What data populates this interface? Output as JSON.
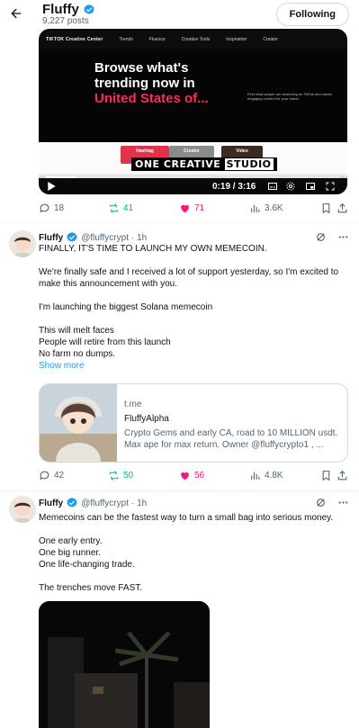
{
  "header": {
    "name": "Fluffy",
    "post_count": "9,227 posts",
    "follow_button": "Following"
  },
  "video": {
    "nav": [
      "TIKTOK Creative Center",
      "Trends",
      "Fluence",
      "Creative Tools",
      "Inspiration",
      "Creator"
    ],
    "headline_line1": "Browse what's",
    "headline_line2": "trending now in",
    "headline_highlight": "United States of...",
    "side_text": "Find what people are searching on TikTok and create engaging content for your brand.",
    "chips": [
      "Hashtag",
      "Creator",
      "Video"
    ],
    "overlay_brand": "ONE CREATIVE",
    "overlay_brand_highlight": "STUDIO",
    "time": "0:19 / 3:16",
    "progress": 0.1
  },
  "post1_actions": {
    "replies": "18",
    "reposts": "41",
    "likes": "71",
    "views": "3.6K"
  },
  "tweet2": {
    "name": "Fluffy",
    "handle": "@fluffycrypt",
    "time": "· 1h",
    "lines": [
      "FINALLY, IT'S TIME TO LAUNCH MY OWN MEMECOIN.",
      "We're finally safe and I received a lot of support yesterday, so I'm excited to make this announcement with you.",
      "I'm launching the biggest Solana memecoin",
      "This will melt faces\nPeople will retire from this launch\nNo farm no dumps."
    ],
    "show_more": "Show more",
    "card": {
      "domain": "t.me",
      "title": "FluffyAlpha",
      "description": "Crypto Gems and early CA, road to 10 MILLION usdt. Max ape for max return. Owner @fluffycrypto1 , ..."
    },
    "actions": {
      "replies": "42",
      "reposts": "50",
      "likes": "56",
      "views": "4.8K"
    }
  },
  "tweet3": {
    "name": "Fluffy",
    "handle": "@fluffycrypt",
    "time": "· 1h",
    "lines": [
      "Memecoins can be the fastest way to turn a small bag into serious money.",
      "One early entry.\nOne big runner.\nOne life-changing trade.",
      "The trenches move FAST."
    ]
  },
  "colors": {
    "accent": "#1d9bf0",
    "repost": "#00ba7c",
    "like": "#f91880",
    "muted": "#536471"
  }
}
